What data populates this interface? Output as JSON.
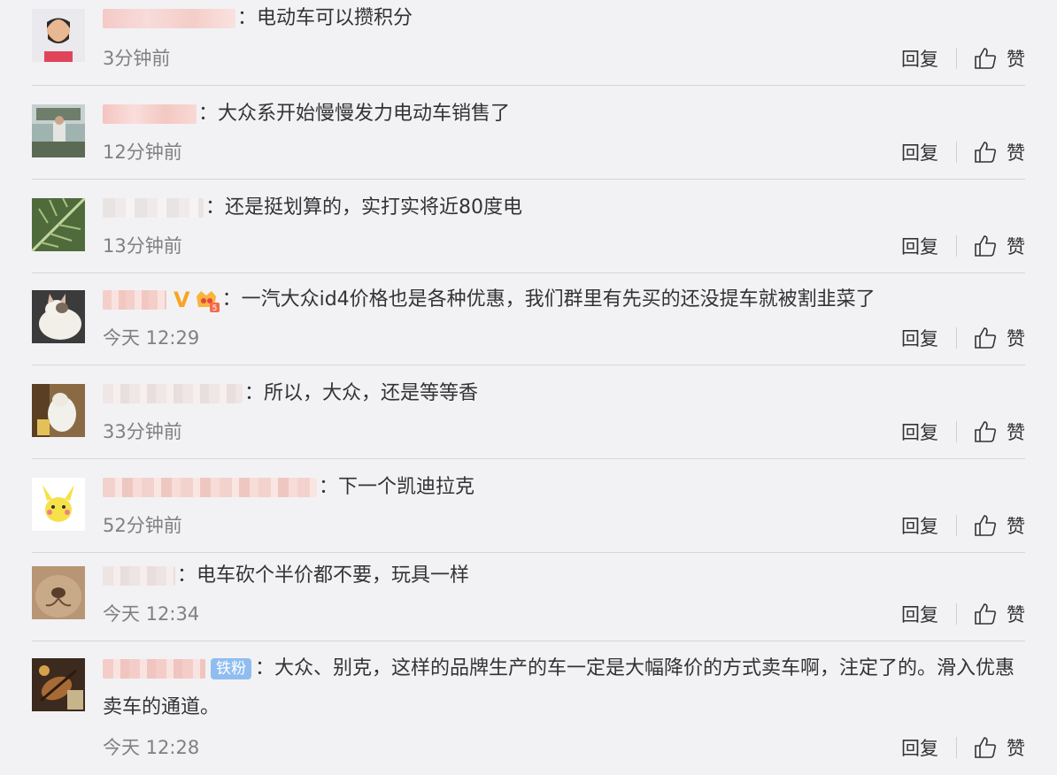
{
  "comments": [
    {
      "username": "Iv...aYi.o",
      "text": "：电动车可以攒积分",
      "time": "3分钟前",
      "reply": "回复",
      "like": "赞"
    },
    {
      "username": "MattShen",
      "text": "：大众系开始慢慢发力电动车销售了",
      "time": "12分钟前",
      "reply": "回复",
      "like": "赞"
    },
    {
      "username": "",
      "text": "：还是挺划算的，实打实将近80度电",
      "time": "13分钟前",
      "reply": "回复",
      "like": "赞"
    },
    {
      "username": "",
      "badge_v": "V",
      "text": "：一汽大众id4价格也是各种优惠，我们群里有先买的还没提车就被割韭菜了",
      "time": "今天 12:29",
      "reply": "回复",
      "like": "赞"
    },
    {
      "username": "",
      "text": "：所以，大众，还是等等香",
      "time": "33分钟前",
      "reply": "回复",
      "like": "赞"
    },
    {
      "username": "",
      "text": "：下一个凯迪拉克",
      "time": "52分钟前",
      "reply": "回复",
      "like": "赞"
    },
    {
      "username": "",
      "text": "：电车砍个半价都不要，玩具一样",
      "time": "今天 12:34",
      "reply": "回复",
      "like": "赞"
    },
    {
      "username": "",
      "badge_fan": "铁粉",
      "text": "：大众、别克，这样的品牌生产的车一定是大幅降价的方式卖车啊，注定了的。滑入优惠卖车的通道。",
      "time": "今天 12:28",
      "reply": "回复",
      "like": "赞"
    }
  ],
  "icons": {
    "like": "thumbs-up-icon",
    "crown": "crown-level-icon",
    "verified": "verified-v-icon"
  },
  "colors": {
    "background": "#f2f2f5",
    "time": "#808080",
    "fan_badge": "#8fbdf0",
    "verified": "#f6a623"
  }
}
